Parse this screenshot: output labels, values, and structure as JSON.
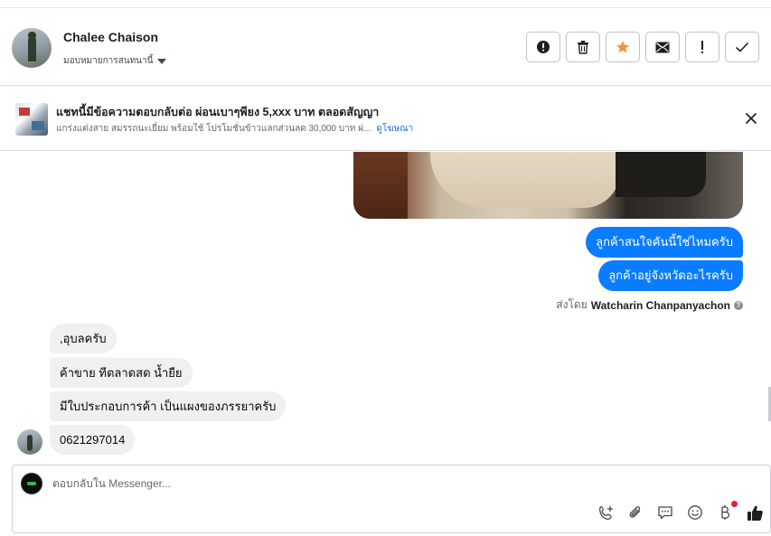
{
  "header": {
    "contact_name": "Chalee Chaison",
    "assign_label": "มอบหมายการสนทนานี้",
    "actions": [
      {
        "name": "spam",
        "icon": "alert-circle-icon"
      },
      {
        "name": "delete",
        "icon": "trash-icon"
      },
      {
        "name": "star",
        "icon": "star-icon"
      },
      {
        "name": "mark-unread",
        "icon": "envelope-icon"
      },
      {
        "name": "follow-up",
        "icon": "exclamation-icon"
      },
      {
        "name": "done",
        "icon": "check-icon"
      }
    ]
  },
  "banner": {
    "title": "แชทนี้มีข้อความตอบกลับต่อ ผ่อนเบาๆพียง 5,xxx บาท ตลอดสัญญา",
    "subtitle": "แกร่งแต่งสาย สมรรถนะเยี่ยม พร้อมใช้ โปรโมชั่นข้าวแลกส่วนลด 30,000 บาท ผ่...",
    "link": "ดูโฆษณา"
  },
  "thread": {
    "outgoing": [
      "ลูกค้าสนใจคันนี้ใช่ไหมครับ",
      "ลูกค้าอยู่จังหวัดอะไรครับ"
    ],
    "sent_by_prefix": "ส่งโดย",
    "sent_by_name": "Watcharin Chanpanyachon",
    "incoming": [
      ",อุบลครับ",
      "ค้าขาย ทีตลาดสด น้ำยืย",
      "มีใบประกอบการค้า เป็นแผงของภรรยาครับ",
      "0621297014"
    ]
  },
  "composer": {
    "placeholder": "ตอบกลับใน Messenger...",
    "tools": [
      "call-add-icon",
      "paperclip-icon",
      "saved-reply-icon",
      "emoji-icon",
      "baht-icon",
      "thumbs-up-icon"
    ]
  },
  "colors": {
    "accent": "#0a7cff",
    "link": "#216fdb",
    "star": "#f7923b",
    "incoming_bg": "#f0f0f0"
  }
}
